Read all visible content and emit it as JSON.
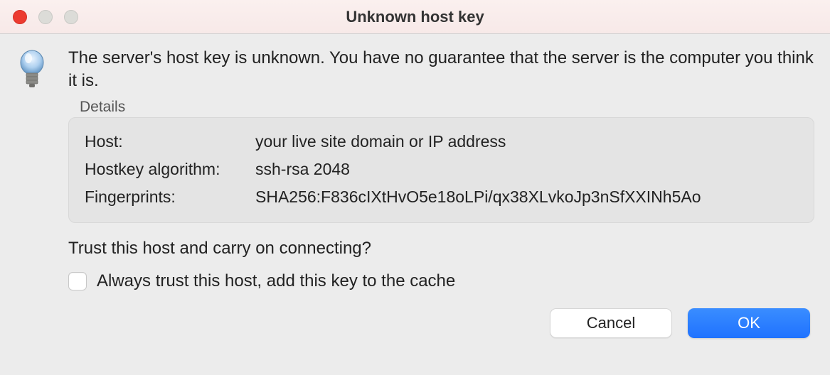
{
  "window": {
    "title": "Unknown host key"
  },
  "dialog": {
    "message": "The server's host key is unknown. You have no guarantee that the server is the computer you think it is.",
    "details_label": "Details",
    "details": {
      "host_label": "Host:",
      "host_value": "your live site domain or IP address",
      "algorithm_label": "Hostkey algorithm:",
      "algorithm_value": "ssh-rsa 2048",
      "fingerprints_label": "Fingerprints:",
      "fingerprints_value": "SHA256:F836cIXtHvO5e18oLPi/qx38XLvkoJp3nSfXXINh5Ao"
    },
    "trust_question": "Trust this host and carry on connecting?",
    "checkbox_label": "Always trust this host, add this key to the cache"
  },
  "buttons": {
    "cancel": "Cancel",
    "ok": "OK"
  }
}
